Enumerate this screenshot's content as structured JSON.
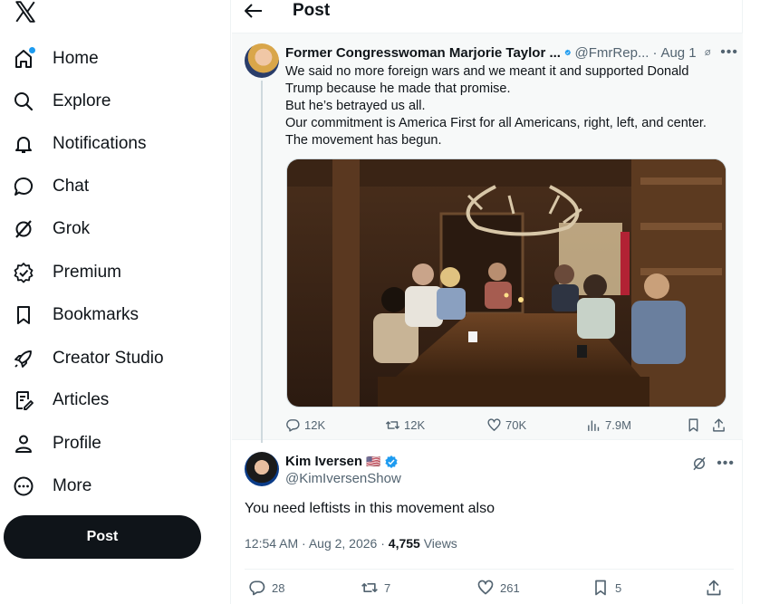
{
  "sidebar": {
    "logo_icon": "x-logo-icon",
    "items": [
      {
        "label": "Home",
        "icon": "home-icon"
      },
      {
        "label": "Explore",
        "icon": "search-icon"
      },
      {
        "label": "Notifications",
        "icon": "bell-icon"
      },
      {
        "label": "Chat",
        "icon": "chat-bubble-icon"
      },
      {
        "label": "Grok",
        "icon": "grok-icon"
      },
      {
        "label": "Premium",
        "icon": "verified-badge-icon"
      },
      {
        "label": "Bookmarks",
        "icon": "bookmark-icon"
      },
      {
        "label": "Creator Studio",
        "icon": "rocket-icon"
      },
      {
        "label": "Articles",
        "icon": "article-icon"
      },
      {
        "label": "Profile",
        "icon": "person-icon"
      },
      {
        "label": "More",
        "icon": "more-circle-icon"
      }
    ],
    "post_label": "Post"
  },
  "header": {
    "title": "Post"
  },
  "quoted_tweet": {
    "name": "Former Congresswoman Marjorie Taylor ...",
    "handle": "@FmrRep...",
    "time": "Aug 1",
    "lines": [
      "We said no more foreign wars and we meant it and supported Donald",
      "Trump because he made that promise.",
      "But he’s betrayed us all.",
      "Our commitment is America First for all Americans, right, left, and center.",
      "The movement has begun."
    ],
    "stats": {
      "replies": "12K",
      "reposts": "12K",
      "likes": "70K",
      "views": "7.9M"
    }
  },
  "reply": {
    "name": "Kim Iversen",
    "flag": "🇺🇸",
    "handle": "@KimIversenShow",
    "text": "You need leftists in this movement also",
    "time": "12:54 AM · Aug 2, 2026 · ",
    "views_count": "4,755",
    "views_label": "Views",
    "stats": {
      "replies": "28",
      "reposts": "7",
      "likes": "261",
      "bookmarks": "5"
    }
  },
  "colors": {
    "accent": "#1d9bf0",
    "text": "#0f1419",
    "muted": "#536471"
  }
}
